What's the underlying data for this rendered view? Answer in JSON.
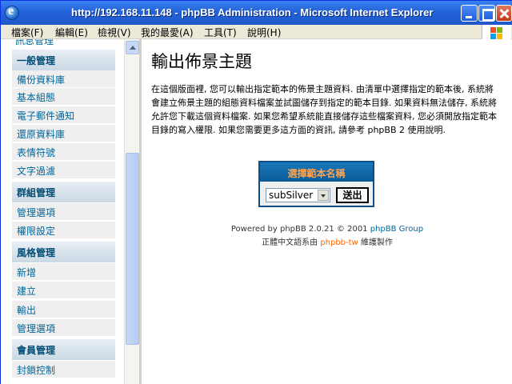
{
  "window": {
    "title": "http://192.168.11.148 - phpBB Administration - Microsoft Internet Explorer"
  },
  "menubar": {
    "items": [
      "檔案(F)",
      "編輯(E)",
      "檢視(V)",
      "我的最愛(A)",
      "工具(T)",
      "說明(H)"
    ]
  },
  "sidebar": {
    "partial_top": "訊息管理",
    "sections": [
      {
        "title": "一般管理",
        "items": [
          "備份資料庫",
          "基本組態",
          "電子郵件通知",
          "還原資料庫",
          "表情符號",
          "文字過濾"
        ]
      },
      {
        "title": "群組管理",
        "items": [
          "管理選項",
          "權限設定"
        ]
      },
      {
        "title": "風格管理",
        "items": [
          "新增",
          "建立",
          "輸出",
          "管理選項"
        ]
      },
      {
        "title": "會員管理",
        "items": [
          "封鎖控制"
        ]
      }
    ]
  },
  "main": {
    "title": "輸出佈景主題",
    "description": "在這個版面裡, 您可以輸出指定範本的佈景主題資料. 由清單中選擇指定的範本後, 系統將會建立佈景主題的組態資料檔案並試圖儲存到指定的範本目錄. 如果資料無法儲存, 系統將允許您下載這個資料檔案. 如果您希望系統能直接儲存這些檔案資料, 您必須開放指定範本目錄的寫入權限. 如果您需要更多這方面的資訊, 請參考 phpBB 2 使用說明.",
    "select_header": "選擇範本名稱",
    "select_value": "subSilver",
    "submit_label": "送出"
  },
  "footer": {
    "powered_prefix": "Powered by phpBB 2.0.21 © 2001 ",
    "powered_link": "phpBB Group",
    "credit_prefix": "正體中文語系由 ",
    "credit_link": "phpbb-tw",
    "credit_suffix": " 維護製作"
  }
}
